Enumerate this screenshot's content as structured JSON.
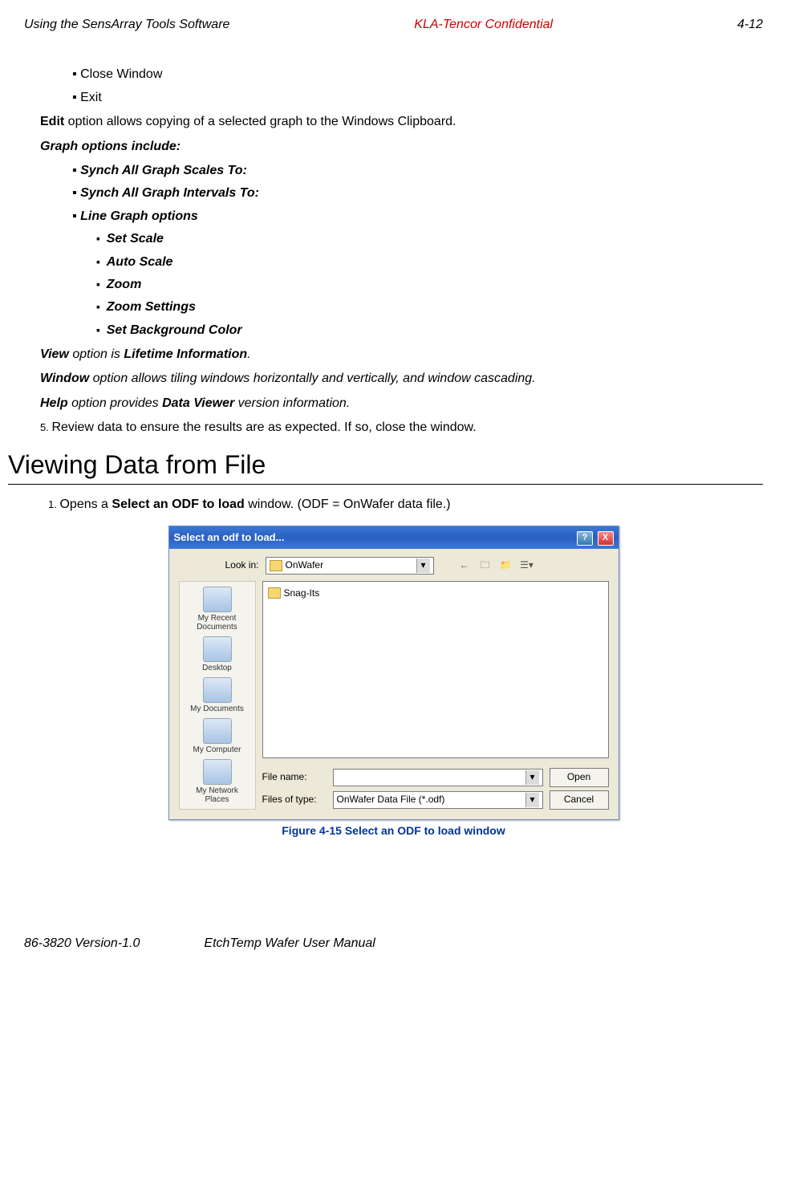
{
  "header": {
    "left": "Using the SensArray Tools Software",
    "center": "KLA-Tencor Confidential",
    "right": "4-12"
  },
  "bullets_l1": {
    "close": "Close Window",
    "exit": "Exit"
  },
  "para_edit": {
    "b": "Edit",
    "rest": " option allows copying of a selected graph to the Windows Clipboard."
  },
  "graph_heading": "Graph options include:",
  "graph_l1": {
    "synch_scales": "Synch All Graph Scales To:",
    "synch_intervals": "Synch All Graph Intervals To:",
    "line_graph": "Line Graph options"
  },
  "graph_l2": {
    "set_scale": "Set Scale",
    "auto_scale": "Auto Scale",
    "zoom": "Zoom",
    "zoom_settings": "Zoom Settings",
    "set_bg": "Set Background Color"
  },
  "para_view": {
    "a": "View",
    "b": " option is ",
    "c": "Lifetime Information",
    "d": "."
  },
  "para_window": {
    "a": "Window",
    "b": " option allows tiling windows horizontally and vertically, and window cascading."
  },
  "para_help": {
    "a": "Help",
    "b": " option provides ",
    "c": "Data Viewer",
    "d": " version information."
  },
  "step5": {
    "n": "5. ",
    "t": "Review data to ensure the results are as expected. If so, close the window."
  },
  "section_title": "Viewing Data from File",
  "step1": {
    "n": "1. ",
    "a": "Opens a ",
    "b": "Select an ODF to load",
    "c": " window. (ODF = OnWafer data file.)"
  },
  "dialog": {
    "title": "Select an odf to load...",
    "look_in_label": "Look in:",
    "look_in_value": "OnWafer",
    "file_item": "Snag-Its",
    "places": [
      "My Recent Documents",
      "Desktop",
      "My Documents",
      "My Computer",
      "My Network Places"
    ],
    "file_name_label": "File name:",
    "file_name_value": "",
    "files_of_type_label": "Files of type:",
    "files_of_type_value": "OnWafer Data File (*.odf)",
    "open": "Open",
    "cancel": "Cancel"
  },
  "figure_caption": "Figure 4-15 Select an ODF to load window",
  "footer": {
    "left": "86-3820 Version-1.0",
    "right": "EtchTemp Wafer User Manual"
  }
}
